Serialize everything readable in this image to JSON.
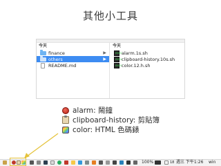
{
  "slide": {
    "title": "其他小工具"
  },
  "finder": {
    "left_header": "今天",
    "right_header": "今天",
    "left_items": [
      {
        "label": "finance",
        "icon": "folder-icon",
        "selected": false,
        "chevron": "▶"
      },
      {
        "label": "others",
        "icon": "folder-icon",
        "selected": true,
        "chevron": "▶"
      },
      {
        "label": "README.md",
        "icon": "document-icon",
        "selected": false
      }
    ],
    "right_items": [
      {
        "label": "alarm.1s.sh",
        "icon": "executable-icon",
        "icon_text": "exec"
      },
      {
        "label": "clipboard-history.10s.sh",
        "icon": "executable-icon",
        "icon_text": "exec"
      },
      {
        "label": "color.12.h.sh",
        "icon": "executable-icon",
        "icon_text": "exec"
      }
    ]
  },
  "legend": [
    {
      "text": "alarm: 鬧鐘",
      "icon": "alarm-icon"
    },
    {
      "text": "clipboard-history: 剪貼簿",
      "icon": "clipboard-icon"
    },
    {
      "text": "color: HTML 色碼錶",
      "icon": "color-picker-icon"
    }
  ],
  "menubar": {
    "battery": "100%",
    "calendar_day": "18",
    "clock": "週三 下午1:26",
    "username": "win"
  },
  "colors": {
    "selection": "#3d8cf2",
    "arrow": "#e5c33c",
    "highlight": "#e5c33c"
  }
}
